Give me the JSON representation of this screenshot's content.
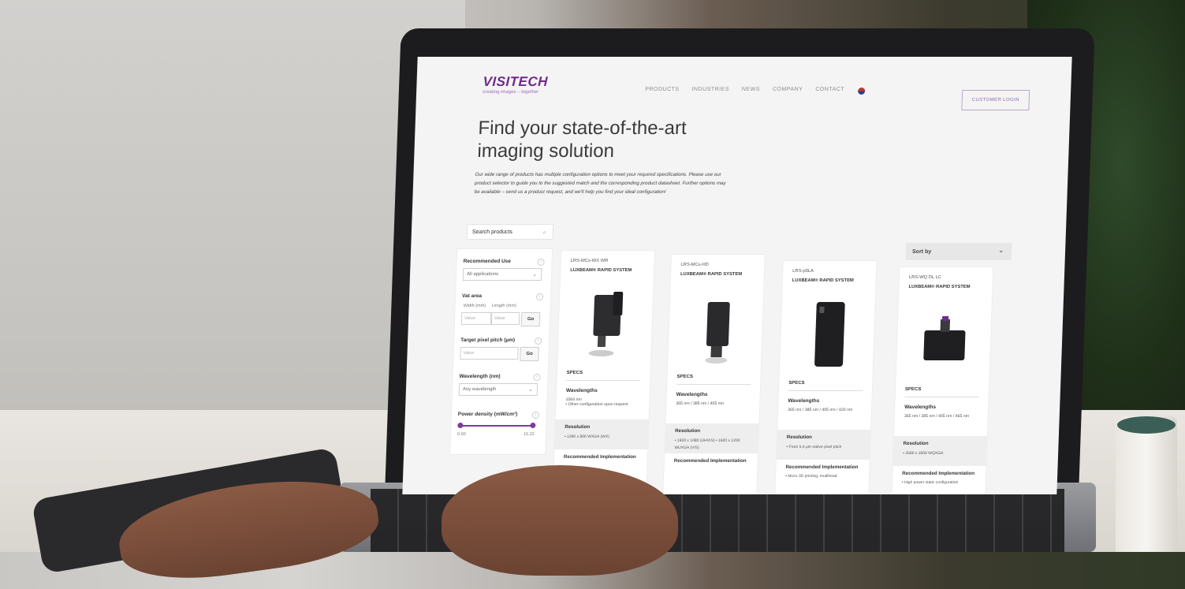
{
  "brand": {
    "logo": "VISITECH",
    "tagline": "creating images – together"
  },
  "nav": {
    "items": [
      "PRODUCTS",
      "INDUSTRIES",
      "NEWS",
      "COMPANY",
      "CONTACT"
    ],
    "login": "CUSTOMER LOGIN"
  },
  "hero": {
    "title": "Find your state-of-the-art imaging solution",
    "intro": "Our wide range of products has multiple configuration options to meet your required specifications. Please use our product selector to guide you to the suggested match and the corresponding product datasheet. Further options may be available – send us a product request, and we'll help you find your ideal configuration!"
  },
  "search": {
    "placeholder": "Search products"
  },
  "filters": {
    "recommended_use": {
      "label": "Recommended Use",
      "value": "All applications"
    },
    "vat_area": {
      "label": "Vat area",
      "width_label": "Width (mm)",
      "length_label": "Length (mm)",
      "placeholder": "Value",
      "go": "Go"
    },
    "pixel_pitch": {
      "label": "Target pixel pitch (µm)",
      "placeholder": "Value",
      "go": "Go"
    },
    "wavelength": {
      "label": "Wavelength (nm)",
      "value": "Any wavelength"
    },
    "power_density": {
      "label": "Power density (mW/cm²)",
      "min": "0.00",
      "max": "15.22"
    }
  },
  "sort": {
    "label": "Sort by"
  },
  "products": [
    {
      "code": "LRS-MCx-WX WR",
      "name": "LUXBEAM® RAPID SYSTEM",
      "specs": "SPECS",
      "wavelengths_h": "Wavelengths",
      "wavelengths": "1064 nm",
      "wavelengths_extra": "• Other configuration upon request",
      "resolution_h": "Resolution",
      "resolution": "• 1280 x 800 WXGA (WX)",
      "impl_h": "Recommended Implementation",
      "impl": ""
    },
    {
      "code": "LRS-MCx-HD",
      "name": "LUXBEAM® RAPID SYSTEM",
      "specs": "SPECS",
      "wavelengths_h": "Wavelengths",
      "wavelengths": "365 nm / 385 nm / 405 nm",
      "wavelengths_extra": "",
      "resolution_h": "Resolution",
      "resolution": "• 1920 x 1080 (UHVIS) • 1920 x 1200 WUXGA (VIS)",
      "impl_h": "Recommended Implementation",
      "impl": ""
    },
    {
      "code": "LRS-p5LA",
      "name": "LUXBEAM® RAPID SYSTEM",
      "specs": "SPECS",
      "wavelengths_h": "Wavelengths",
      "wavelengths": "365 nm / 385 nm / 405 nm / 420 nm",
      "wavelengths_extra": "",
      "resolution_h": "Resolution",
      "resolution": "• From 5.4 µm native pixel pitch",
      "impl_h": "Recommended Implementation",
      "impl": "• Micro 3D printing, multihead"
    },
    {
      "code": "LRS-WQ DL LC",
      "name": "LUXBEAM® RAPID SYSTEM",
      "specs": "SPECS",
      "wavelengths_h": "Wavelengths",
      "wavelengths": "365 nm / 385 nm / 405 nm / 465 nm",
      "wavelengths_extra": "",
      "resolution_h": "Resolution",
      "resolution": "• 2560 x 1600 WQXGA",
      "impl_h": "Recommended Implementation",
      "impl": "• High power static configuration"
    }
  ],
  "colors": {
    "brand": "#6e2b8c",
    "accent": "#7b3f99"
  }
}
